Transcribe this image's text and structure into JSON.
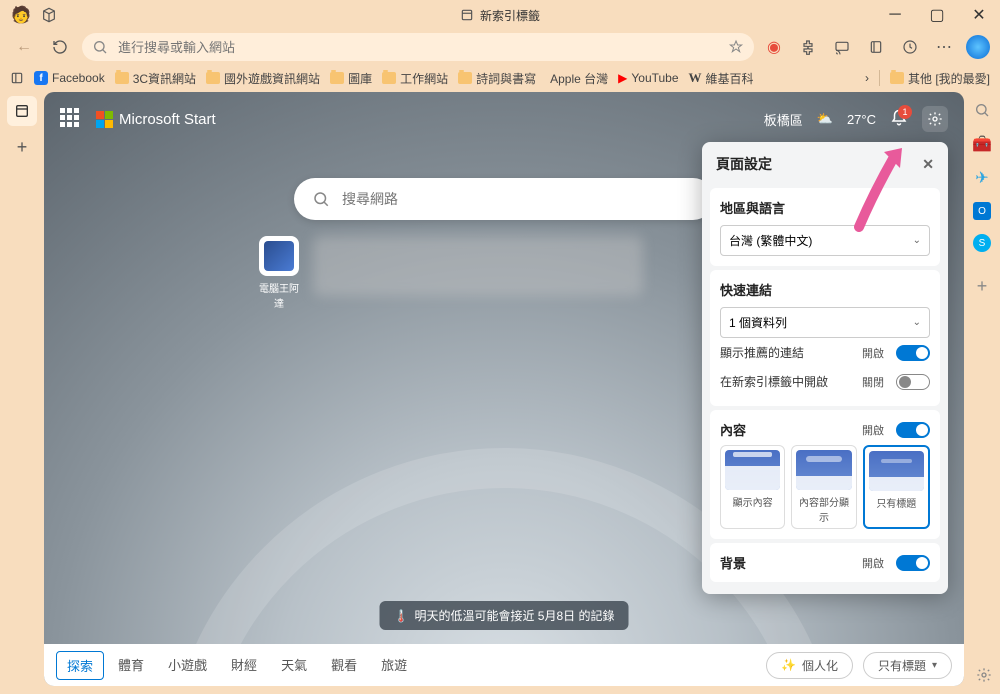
{
  "title": "新索引標籤",
  "address": {
    "placeholder": "進行搜尋或輸入網站"
  },
  "bookmarks": {
    "items": [
      "Facebook",
      "3C資訊網站",
      "國外遊戲資訊網站",
      "圖庫",
      "工作網站",
      "詩詞與書寫",
      "Apple 台灣",
      "YouTube",
      "維基百科"
    ],
    "other": "其他 [我的最愛]"
  },
  "msstart": {
    "brand": "Microsoft Start",
    "location": "板橋區",
    "temp": "27°C",
    "notif_count": "1"
  },
  "search": {
    "placeholder": "搜尋網路"
  },
  "tile": {
    "label": "電腦王阿達"
  },
  "note": "明天的低溫可能會接近 5月8日 的記錄",
  "bottom_tabs": [
    "探索",
    "體育",
    "小遊戲",
    "財經",
    "天氣",
    "觀看",
    "旅遊"
  ],
  "personalize": "個人化",
  "layout_pill": "只有標題",
  "settings": {
    "title": "頁面設定",
    "region_title": "地區與語言",
    "region_value": "台灣 (繁體中文)",
    "quick_title": "快速連結",
    "quick_value": "1 個資料列",
    "row_promoted": "顯示推薦的連結",
    "row_promoted_state": "開啟",
    "row_newtab": "在新索引標籤中開啟",
    "row_newtab_state": "關閉",
    "content_title": "內容",
    "content_state": "開啟",
    "layouts": [
      "顯示內容",
      "內容部分顯示",
      "只有標題"
    ],
    "bg_title": "背景",
    "bg_state": "開啟"
  }
}
